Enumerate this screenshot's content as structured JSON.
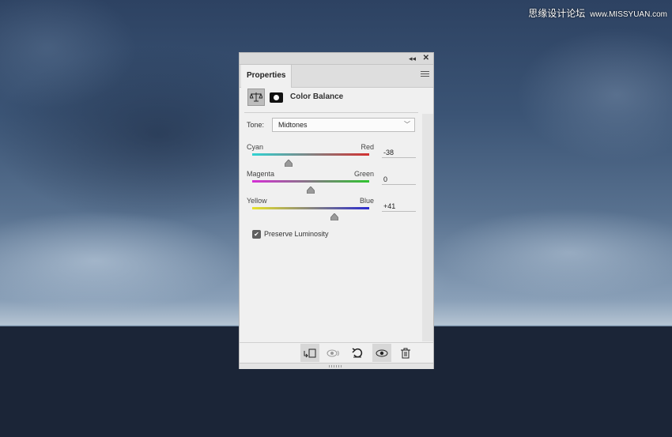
{
  "watermark": {
    "text": "思缘设计论坛",
    "url": "www.MISSYUAN.com"
  },
  "panel": {
    "tab_label": "Properties",
    "title": "Color Balance",
    "tone": {
      "label": "Tone:",
      "value": "Midtones"
    },
    "sliders": [
      {
        "left": "Cyan",
        "right": "Red",
        "value": "-38",
        "level": -38,
        "colors": [
          "#2fd3d3",
          "#d33030"
        ]
      },
      {
        "left": "Magenta",
        "right": "Green",
        "value": "0",
        "level": 0,
        "colors": [
          "#d52fd5",
          "#2fc42f"
        ]
      },
      {
        "left": "Yellow",
        "right": "Blue",
        "value": "+41",
        "level": 41,
        "colors": [
          "#e7e22a",
          "#2a2ad0"
        ]
      }
    ],
    "preserve_luminosity": {
      "label": "Preserve Luminosity",
      "checked": true
    }
  },
  "icons": {
    "collapse": "double-chevron-left-icon",
    "close": "close-icon",
    "menu": "hamburger-menu-icon",
    "adjustment": "balance-scale-icon",
    "mask": "layer-mask-icon",
    "clip": "clip-to-layer-icon",
    "view_previous": "view-previous-state-icon",
    "reset": "reset-icon",
    "visibility": "eye-icon",
    "delete": "trash-icon"
  }
}
